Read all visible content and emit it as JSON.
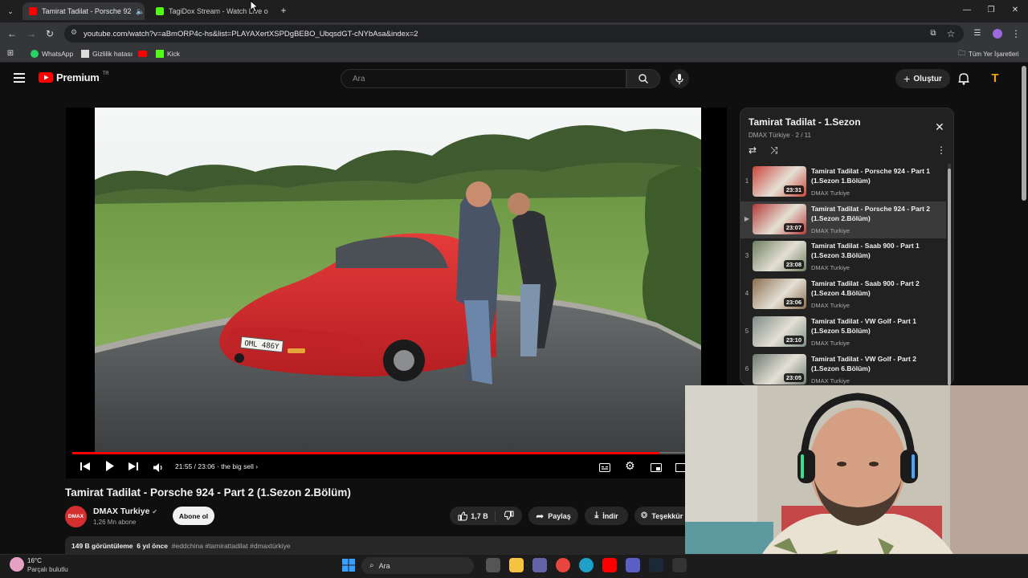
{
  "browser": {
    "tabs": [
      {
        "label": "Tamirat Tadilat - Porsche 92",
        "active": true
      },
      {
        "label": "TagiDox Stream - Watch Live o",
        "active": false
      }
    ],
    "url": "youtube.com/watch?v=aBmORP4c-hs&list=PLAYAXertXSPDgBEBO_UbqsdGT-cNYbAsa&index=2",
    "bookmarks": [
      "WhatsApp",
      "Gizlilik hatası",
      "Kick"
    ],
    "all_bookmarks": "Tüm Yer İşaretleri"
  },
  "header": {
    "brand": "Premium",
    "brand_sup": "TR",
    "search_placeholder": "Ara",
    "create_label": "Oluştur",
    "avatar_letter": "T"
  },
  "player": {
    "time_current": "21:55",
    "time_total": "23:06",
    "chapter": "the big sell",
    "progress_fraction": 0.949,
    "plate": "OML 486Y"
  },
  "video": {
    "title": "Tamirat Tadilat - Porsche 924 - Part 2 (1.Sezon 2.Bölüm)",
    "channel": "DMAX Turkiye",
    "channel_logo": "DMAX",
    "subscribers": "1,26 Mn abone",
    "subscribe_label": "Abone ol",
    "likes": "1,7 B",
    "share_label": "Paylaş",
    "download_label": "İndir",
    "thanks_label": "Teşekkür",
    "views": "149 B görüntüleme",
    "age": "6 yıl önce",
    "hashtags": "#eddchina #tamirattadilat #dmaxtürkiye"
  },
  "playlist": {
    "title": "Tamirat Tadilat - 1.Sezon",
    "subtitle": "DMAX Türkiye · 2 / 11",
    "items": [
      {
        "index": "1",
        "title": "Tamirat Tadilat - Porsche 924 - Part 1 (1.Sezon 1.Bölüm)",
        "channel": "DMAX Turkiye",
        "duration": "23:31",
        "current": false
      },
      {
        "index": "▶",
        "title": "Tamirat Tadilat - Porsche 924 - Part 2 (1.Sezon 2.Bölüm)",
        "channel": "DMAX Turkiye",
        "duration": "23:07",
        "current": true
      },
      {
        "index": "3",
        "title": "Tamirat Tadilat - Saab 900 - Part 1 (1.Sezon 3.Bölüm)",
        "channel": "DMAX Turkiye",
        "duration": "23:08",
        "current": false
      },
      {
        "index": "4",
        "title": "Tamirat Tadilat - Saab 900 - Part 2 (1.Sezon 4.Bölüm)",
        "channel": "DMAX Turkiye",
        "duration": "23:06",
        "current": false
      },
      {
        "index": "5",
        "title": "Tamirat Tadilat - VW Golf - Part 1 (1.Sezon 5.Bölüm)",
        "channel": "DMAX Turkiye",
        "duration": "23:10",
        "current": false
      },
      {
        "index": "6",
        "title": "Tamirat Tadilat - VW Golf - Part 2 (1.Sezon 6.Bölüm)",
        "channel": "DMAX Turkiye",
        "duration": "23:05",
        "current": false
      }
    ]
  },
  "taskbar": {
    "temp": "16°C",
    "weather": "Parçalı bulutlu",
    "search_label": "Ara"
  },
  "colors": {
    "yt_red": "#ff0000",
    "bg": "#0f0f0f",
    "car_red": "#d8282b"
  }
}
